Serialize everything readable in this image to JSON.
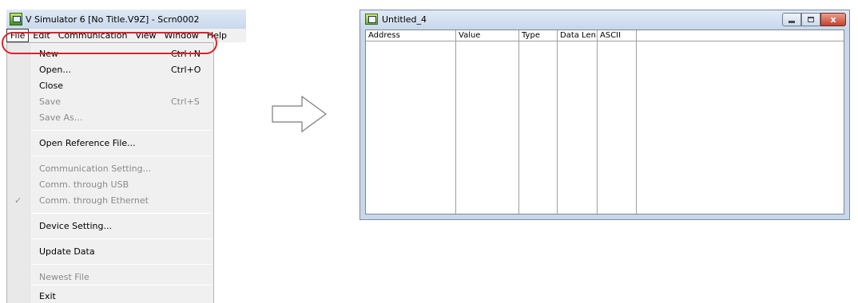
{
  "simulator": {
    "title": "V Simulator 6 [No Title.V9Z] - Scrn0002",
    "menubar": [
      "File",
      "Edit",
      "Communication",
      "View",
      "Window",
      "Help"
    ],
    "file_menu": {
      "new": {
        "label": "New",
        "shortcut": "Ctrl+N"
      },
      "open": {
        "label": "Open...",
        "shortcut": "Ctrl+O"
      },
      "close": {
        "label": "Close"
      },
      "save": {
        "label": "Save",
        "shortcut": "Ctrl+S"
      },
      "save_as": {
        "label": "Save As..."
      },
      "open_reference": {
        "label": "Open Reference File..."
      },
      "comm_setting": {
        "label": "Communication Setting..."
      },
      "comm_usb": {
        "label": "Comm. through USB"
      },
      "comm_ethernet": {
        "label": "Comm. through Ethernet",
        "check": "✓"
      },
      "device_setting": {
        "label": "Device Setting..."
      },
      "update_data": {
        "label": "Update Data"
      },
      "newest_file": {
        "label": "Newest File"
      },
      "exit": {
        "label": "Exit"
      }
    }
  },
  "data_window": {
    "title": "Untitled_4",
    "close_glyph": "x",
    "columns": [
      "Address",
      "Value",
      "Type",
      "Data Len",
      "ASCII"
    ]
  },
  "colors": {
    "highlight": "#e0202a",
    "close_button": "#c5412c"
  }
}
